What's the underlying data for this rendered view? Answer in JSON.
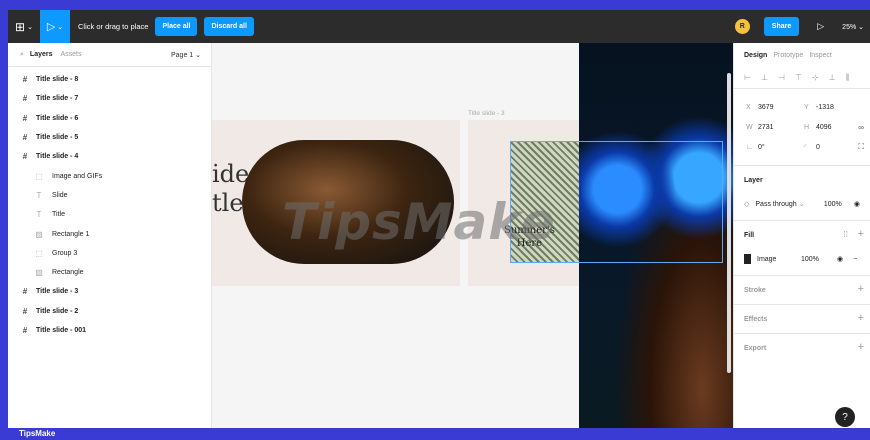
{
  "toolbar": {
    "hint": "Click or drag to place",
    "place_all": "Place all",
    "discard_all": "Discard all",
    "avatar_initial": "R",
    "share": "Share",
    "zoom": "25%"
  },
  "left_panel": {
    "tab_layers": "Layers",
    "tab_assets": "Assets",
    "page": "Page 1",
    "items": [
      {
        "label": "Title slide - 8",
        "level": 0,
        "icon": "frame-icon"
      },
      {
        "label": "Title slide - 7",
        "level": 0,
        "icon": "frame-icon"
      },
      {
        "label": "Title slide - 6",
        "level": 0,
        "icon": "frame-icon"
      },
      {
        "label": "Title slide - 5",
        "level": 0,
        "icon": "frame-icon"
      },
      {
        "label": "Title slide - 4",
        "level": 0,
        "icon": "frame-icon"
      },
      {
        "label": "Image and GIFs",
        "level": 1,
        "icon": "group-icon"
      },
      {
        "label": "Slide",
        "level": 1,
        "icon": "text-icon"
      },
      {
        "label": "Title",
        "level": 1,
        "icon": "text-icon"
      },
      {
        "label": "Rectangle 1",
        "level": 1,
        "icon": "image-icon"
      },
      {
        "label": "Group 3",
        "level": 1,
        "icon": "group-icon"
      },
      {
        "label": "Rectangle",
        "level": 1,
        "icon": "image-icon"
      },
      {
        "label": "Title slide - 3",
        "level": 0,
        "icon": "frame-icon"
      },
      {
        "label": "Title slide - 2",
        "level": 0,
        "icon": "frame-icon"
      },
      {
        "label": "Title slide - 001",
        "level": 0,
        "icon": "frame-icon"
      }
    ]
  },
  "canvas": {
    "slide_text_1": "ide",
    "slide_text_2": "tle",
    "slide3_label": "Title slide - 3",
    "summer_1": "Summer's",
    "summer_2": "Here",
    "watermark": "TipsMake"
  },
  "right_panel": {
    "tabs": [
      "Design",
      "Prototype",
      "Inspect"
    ],
    "x_label": "X",
    "x_value": "3679",
    "y_label": "Y",
    "y_value": "-1318",
    "w_label": "W",
    "w_value": "2731",
    "h_label": "H",
    "h_value": "4096",
    "rotation": "0°",
    "corner_radius": "0",
    "layer_title": "Layer",
    "blend_mode": "Pass through",
    "layer_opacity": "100%",
    "fill_title": "Fill",
    "fill_type": "Image",
    "fill_opacity": "100%",
    "stroke_title": "Stroke",
    "effects_title": "Effects",
    "export_title": "Export"
  },
  "help": "?",
  "footer": "TipsMake",
  "colors": {
    "accent": "#0d99ff",
    "toolbar_bg": "#2c2c2c",
    "footer_bg": "#3a3ad4"
  }
}
